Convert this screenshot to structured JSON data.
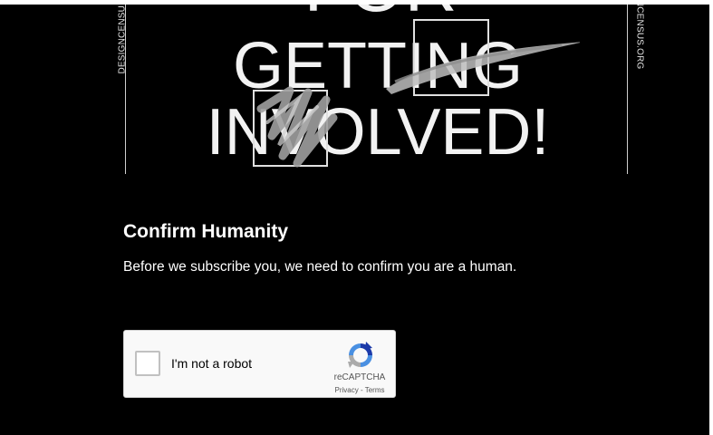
{
  "hero": {
    "line_for": "FOR",
    "line_getting": "GETTING",
    "line_involved": "INVOLVED!",
    "side_left": "DESIGNCENSU",
    "side_right": "NCENSUS.ORG"
  },
  "confirm": {
    "title": "Confirm Humanity",
    "description": "Before we subscribe you, we need to confirm you are a human."
  },
  "recaptcha": {
    "label": "I'm not a robot",
    "brand": "reCAPTCHA",
    "privacy": "Privacy",
    "separator": " - ",
    "terms": "Terms",
    "checked": false
  },
  "colors": {
    "background": "#000000",
    "text": "#ffffff",
    "recaptcha_bg": "#f9f9f9",
    "recaptcha_border": "#d3d3d3"
  }
}
